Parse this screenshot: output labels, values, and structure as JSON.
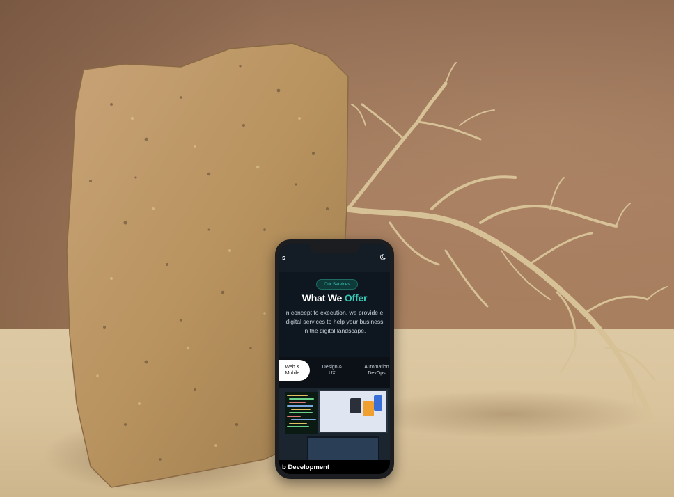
{
  "mockup": {
    "brand_letter": "s",
    "services_pill": "Our Services",
    "heading_main": "What We",
    "heading_accent": "Offer",
    "description_line1": "n concept to execution, we provide e",
    "description_line2": "digital services to help your business",
    "description_line3": "in the digital landscape.",
    "tabs": [
      {
        "label_line1": "Web &",
        "label_line2": "Mobile"
      },
      {
        "label_line1": "Design &",
        "label_line2": "UX"
      },
      {
        "label_line1": "Automation",
        "label_line2": "DevOps"
      }
    ],
    "footer_label": "b Development"
  },
  "colors": {
    "accent": "#37c9b6",
    "screen_bg": "#0e1720",
    "wall": "#a57c5f",
    "table": "#dcc9a4"
  }
}
